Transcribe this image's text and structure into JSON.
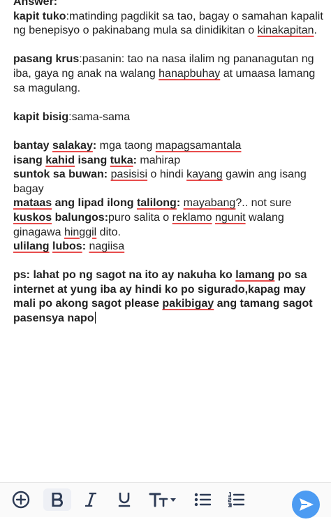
{
  "answer_header": "Answer:",
  "p1": {
    "term": "kapit tuko",
    "def_a": ":matinding pagdikit sa tao, bagay o samahan kapalit ng benepisyo o pakinabang mula sa dinidikitan o ",
    "u1": "kinakapitan",
    "def_end": "."
  },
  "p2": {
    "term": "pasang krus",
    "def_a": ":pasanin: tao na nasa ilalim ng pananagutan ng iba, gaya ng anak na walang ",
    "u1": "hanapbuhay",
    "def_end": " at umaasa lamang sa magulang."
  },
  "p3": {
    "term": "kapit bisig",
    "def": ":sama-sama"
  },
  "lines": {
    "l1_a": "bantay ",
    "l1_u": "salakay",
    "l1_b": ":",
    "l1_c": " mga taong ",
    "l1_u2": "mapagsamantala",
    "l2_a": "isang ",
    "l2_u": "kahid",
    "l2_b": " isang ",
    "l2_u2": "tuka",
    "l2_c": ":",
    "l2_d": " mahirap",
    "l3_a": "suntok sa buwan:",
    "l3_b": " ",
    "l3_u": "pasisisi",
    "l3_c": " o hindi ",
    "l3_u2": "kayang",
    "l3_d": " gawin ang isang bagay",
    "l4_u": "mataas",
    "l4_a": " ang lipad ilong ",
    "l4_u2": "talilong",
    "l4_b": ":",
    "l4_c": " ",
    "l4_u3": "mayabang",
    "l4_d": "?.. not sure",
    "l5_u": "kuskos",
    "l5_a": " balungos:",
    "l5_b": "puro salita o ",
    "l5_u2": "reklamo",
    "l5_c": " ",
    "l5_u3": "ngunit",
    "l5_d": " walang ginagawa ",
    "l5_u4": "hinggil",
    "l5_e": " dito.",
    "l6_u": "ulilang",
    "l6_a": " ",
    "l6_u2": "lubos",
    "l6_b": ":",
    "l6_c": " ",
    "l6_u3": "nagiisa"
  },
  "ps": {
    "a": "ps: lahat po ng sagot na ito ay nakuha ko ",
    "u1": "lamang",
    "b": " po sa internet at yung iba ay hindi ko po sigurado,kapag may mali po akong sagot please ",
    "u2": "pakibigay",
    "c": " ang tamang sagot pasensya napo"
  },
  "toolbar": {
    "icons": [
      "plus-circle-icon",
      "bold-icon",
      "italic-icon",
      "underline-icon",
      "text-size-icon",
      "bullet-list-icon",
      "numbered-list-icon",
      "send-icon"
    ],
    "accent": "#4c9bf2",
    "icon_color": "#2d3b55",
    "underline_color": "#e84c4c"
  }
}
